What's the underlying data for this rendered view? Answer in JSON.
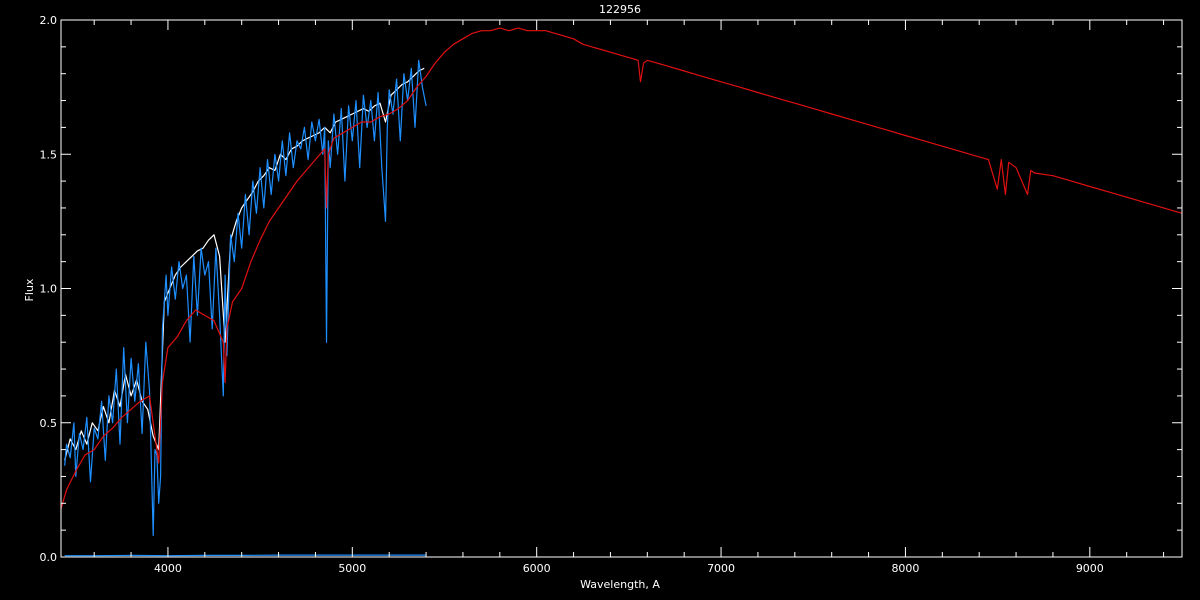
{
  "chart_data": {
    "type": "line",
    "title": "122956",
    "xlabel": "Wavelength, A",
    "ylabel": "Flux",
    "xlim": [
      3420,
      9500
    ],
    "ylim": [
      0.0,
      2.0
    ],
    "grid": false,
    "background": "#000000",
    "x_ticks": [
      4000,
      5000,
      6000,
      7000,
      8000,
      9000
    ],
    "x_tick_labels": [
      "4000",
      "5000",
      "6000",
      "7000",
      "8000",
      "9000"
    ],
    "y_ticks": [
      0.0,
      0.5,
      1.0,
      1.5,
      2.0
    ],
    "y_tick_labels": [
      "0.0",
      "0.5",
      "1.0",
      "1.5",
      "2.0"
    ],
    "series": [
      {
        "color": "#ffffff",
        "x": [
          3440,
          3470,
          3500,
          3530,
          3560,
          3590,
          3620,
          3650,
          3680,
          3710,
          3740,
          3770,
          3800,
          3830,
          3860,
          3890,
          3920,
          3950,
          3980,
          4010,
          4040,
          4070,
          4100,
          4130,
          4160,
          4190,
          4220,
          4250,
          4280,
          4310,
          4340,
          4370,
          4400,
          4430,
          4460,
          4490,
          4520,
          4550,
          4580,
          4610,
          4640,
          4670,
          4700,
          4730,
          4760,
          4790,
          4820,
          4850,
          4880,
          4910,
          4940,
          4970,
          5000,
          5030,
          5060,
          5090,
          5120,
          5150,
          5180,
          5210,
          5240,
          5270,
          5300,
          5330,
          5360,
          5390
        ],
        "y": [
          0.36,
          0.44,
          0.4,
          0.47,
          0.42,
          0.5,
          0.47,
          0.56,
          0.5,
          0.62,
          0.56,
          0.68,
          0.6,
          0.66,
          0.58,
          0.55,
          0.45,
          0.4,
          0.95,
          1.0,
          1.05,
          1.08,
          1.1,
          1.12,
          1.14,
          1.15,
          1.18,
          1.2,
          1.12,
          0.8,
          1.18,
          1.25,
          1.3,
          1.33,
          1.36,
          1.4,
          1.42,
          1.45,
          1.44,
          1.5,
          1.48,
          1.52,
          1.53,
          1.55,
          1.56,
          1.57,
          1.58,
          1.6,
          1.58,
          1.62,
          1.63,
          1.64,
          1.65,
          1.66,
          1.67,
          1.66,
          1.68,
          1.69,
          1.62,
          1.72,
          1.74,
          1.76,
          1.77,
          1.79,
          1.81,
          1.82
        ]
      },
      {
        "color": "#1e8fff",
        "x": [
          3440,
          3450,
          3470,
          3490,
          3500,
          3520,
          3540,
          3560,
          3580,
          3600,
          3620,
          3640,
          3660,
          3680,
          3700,
          3720,
          3740,
          3760,
          3780,
          3800,
          3820,
          3840,
          3860,
          3880,
          3900,
          3920,
          3930,
          3940,
          3950,
          3960,
          3970,
          3980,
          3990,
          4000,
          4020,
          4040,
          4060,
          4080,
          4100,
          4120,
          4140,
          4160,
          4180,
          4200,
          4220,
          4240,
          4260,
          4280,
          4300,
          4310,
          4320,
          4340,
          4360,
          4380,
          4400,
          4420,
          4440,
          4460,
          4480,
          4500,
          4520,
          4540,
          4560,
          4580,
          4600,
          4620,
          4640,
          4660,
          4680,
          4700,
          4720,
          4740,
          4760,
          4780,
          4800,
          4820,
          4840,
          4850,
          4860,
          4870,
          4880,
          4900,
          4920,
          4940,
          4960,
          4980,
          5000,
          5020,
          5040,
          5060,
          5080,
          5100,
          5120,
          5140,
          5160,
          5170,
          5180,
          5190,
          5200,
          5220,
          5240,
          5260,
          5280,
          5300,
          5320,
          5340,
          5360,
          5380,
          5400
        ],
        "y": [
          0.34,
          0.42,
          0.37,
          0.5,
          0.3,
          0.46,
          0.4,
          0.52,
          0.28,
          0.48,
          0.44,
          0.58,
          0.36,
          0.6,
          0.5,
          0.7,
          0.42,
          0.78,
          0.5,
          0.74,
          0.58,
          0.72,
          0.46,
          0.8,
          0.62,
          0.08,
          0.4,
          0.38,
          0.2,
          0.3,
          0.85,
          0.95,
          1.05,
          0.9,
          1.08,
          0.96,
          1.1,
          1.0,
          1.05,
          0.8,
          1.12,
          0.9,
          1.15,
          1.05,
          1.1,
          0.85,
          1.15,
          0.9,
          0.6,
          1.05,
          0.75,
          1.2,
          1.1,
          1.28,
          1.15,
          1.35,
          1.2,
          1.4,
          1.28,
          1.45,
          1.3,
          1.48,
          1.35,
          1.5,
          1.4,
          1.55,
          1.42,
          1.58,
          1.45,
          1.55,
          1.52,
          1.6,
          1.48,
          1.62,
          1.55,
          1.63,
          1.5,
          1.6,
          0.8,
          1.55,
          1.45,
          1.65,
          1.5,
          1.67,
          1.4,
          1.68,
          1.55,
          1.7,
          1.45,
          1.72,
          1.6,
          1.7,
          1.55,
          1.73,
          1.45,
          1.35,
          1.25,
          1.6,
          1.74,
          1.65,
          1.78,
          1.55,
          1.8,
          1.7,
          1.82,
          1.6,
          1.85,
          1.75,
          1.68
        ]
      },
      {
        "color": "#e01010",
        "x": [
          3420,
          3450,
          3500,
          3550,
          3600,
          3650,
          3700,
          3750,
          3800,
          3850,
          3900,
          3930,
          3950,
          3970,
          4000,
          4050,
          4100,
          4150,
          4200,
          4250,
          4300,
          4310,
          4320,
          4350,
          4400,
          4450,
          4500,
          4550,
          4600,
          4650,
          4700,
          4750,
          4800,
          4850,
          4860,
          4870,
          4900,
          4950,
          5000,
          5050,
          5100,
          5150,
          5200,
          5250,
          5300,
          5350,
          5400,
          5450,
          5500,
          5550,
          5600,
          5650,
          5700,
          5750,
          5800,
          5850,
          5900,
          5950,
          6000,
          6050,
          6100,
          6150,
          6200,
          6250,
          6300,
          6350,
          6400,
          6450,
          6500,
          6550,
          6563,
          6580,
          6600,
          6700,
          6800,
          6900,
          7000,
          7100,
          7200,
          7300,
          7400,
          7500,
          7600,
          7700,
          7800,
          7900,
          8000,
          8100,
          8200,
          8300,
          8400,
          8450,
          8498,
          8520,
          8542,
          8560,
          8600,
          8662,
          8680,
          8700,
          8800,
          8900,
          9000,
          9100,
          9200,
          9300,
          9400,
          9500
        ],
        "y": [
          0.18,
          0.25,
          0.32,
          0.38,
          0.4,
          0.45,
          0.48,
          0.52,
          0.55,
          0.58,
          0.6,
          0.45,
          0.35,
          0.65,
          0.78,
          0.82,
          0.88,
          0.92,
          0.9,
          0.88,
          0.8,
          0.65,
          0.85,
          0.95,
          1.0,
          1.1,
          1.18,
          1.25,
          1.3,
          1.35,
          1.4,
          1.44,
          1.48,
          1.52,
          1.3,
          1.5,
          1.56,
          1.58,
          1.6,
          1.62,
          1.62,
          1.64,
          1.65,
          1.67,
          1.7,
          1.75,
          1.79,
          1.84,
          1.88,
          1.91,
          1.93,
          1.95,
          1.96,
          1.96,
          1.97,
          1.96,
          1.97,
          1.96,
          1.96,
          1.96,
          1.95,
          1.94,
          1.93,
          1.91,
          1.9,
          1.89,
          1.88,
          1.87,
          1.86,
          1.85,
          1.77,
          1.84,
          1.85,
          1.83,
          1.81,
          1.79,
          1.77,
          1.75,
          1.73,
          1.71,
          1.69,
          1.67,
          1.65,
          1.63,
          1.61,
          1.59,
          1.57,
          1.55,
          1.53,
          1.51,
          1.49,
          1.48,
          1.37,
          1.48,
          1.35,
          1.47,
          1.45,
          1.35,
          1.44,
          1.43,
          1.42,
          1.4,
          1.38,
          1.36,
          1.34,
          1.32,
          1.3,
          1.28
        ]
      },
      {
        "color": "#1e8fff",
        "x": [
          3440,
          3600,
          3800,
          4000,
          4200,
          4400,
          4600,
          4800,
          5000,
          5200,
          5400
        ],
        "y": [
          0.005,
          0.005,
          0.006,
          0.005,
          0.006,
          0.006,
          0.007,
          0.007,
          0.007,
          0.007,
          0.007
        ]
      }
    ]
  }
}
